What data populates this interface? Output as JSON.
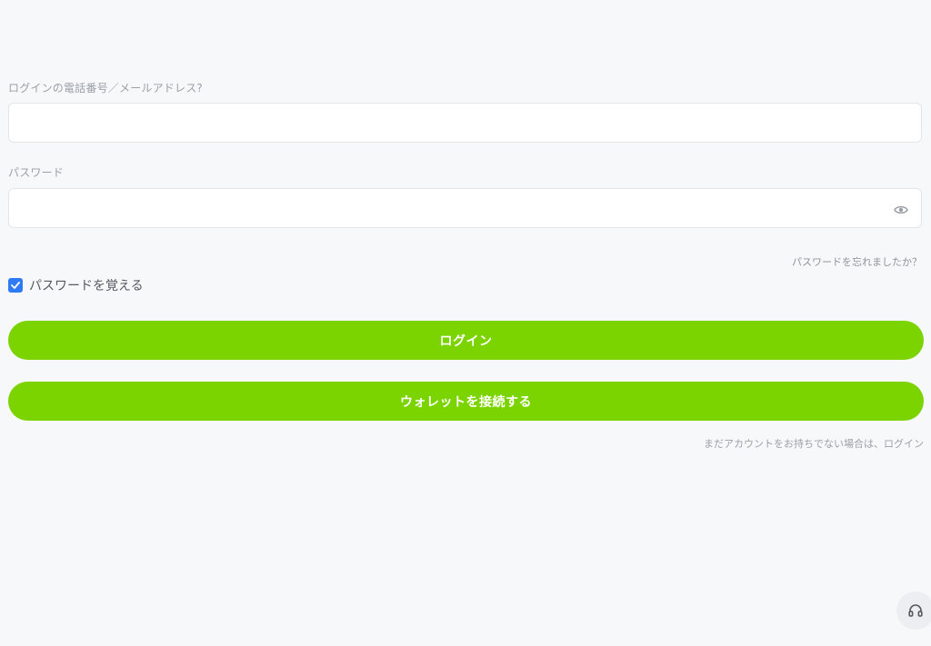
{
  "login_form": {
    "account_label": "ログインの電話番号／メールアドレス?",
    "account_value": "",
    "account_placeholder": "",
    "password_label": "パスワード",
    "password_value": "",
    "password_placeholder": "",
    "forgot_password": "パスワードを忘れましたか？",
    "remember_label": "パスワードを覚える",
    "remember_checked": true,
    "login_button": "ログイン",
    "wallet_button": "ウォレットを接続する",
    "signup_prompt": "まだアカウントをお持ちでない場合は、",
    "signup_link": "ログイン"
  },
  "icons": {
    "password_toggle": "eye-icon",
    "remember_check": "check-icon",
    "support": "headset-icon"
  },
  "colors": {
    "background": "#f7f8fa",
    "primary_button": "#7bd400",
    "checkbox": "#2f7bf5",
    "label_text": "#9aa0a6"
  }
}
